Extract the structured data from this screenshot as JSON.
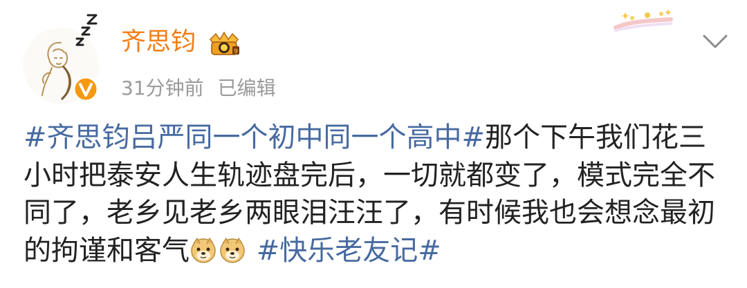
{
  "post": {
    "author": "齐思钧",
    "time": "31分钟前",
    "edited": "已编辑",
    "line1_tag": "#齐思钧吕严同一个初中同一个高中#",
    "line1_text": "那个下午我们花三",
    "line2_text": "小时把泰安人生轨迹盘完后，一切就都变了，模式完全不",
    "line3_text": "同了，老乡见老乡两眼泪汪汪了，有时候我也会想念最初",
    "line4_text": "的拘谨和客气",
    "line4_tag": "#快乐老友记#",
    "emojis": [
      "doge-emoji",
      "doge-emoji"
    ]
  },
  "icons": {
    "avatar": "avatar-illustration",
    "badge": "vip-crown-badge",
    "verified": "verified-v-icon",
    "menu": "chevron-down-icon",
    "decor": "card-decoration-icon"
  },
  "colors": {
    "username": "#f47d14",
    "hashtag": "#476aa0",
    "meta": "#9a9a9a",
    "text": "#222222",
    "verified": "#f49a12"
  }
}
